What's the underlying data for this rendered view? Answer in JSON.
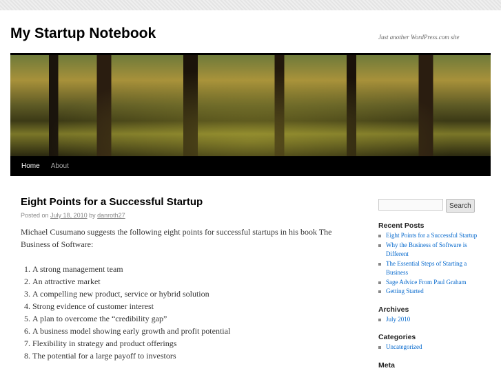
{
  "site": {
    "title": "My Startup Notebook",
    "description": "Just another WordPress.com site"
  },
  "nav": [
    "Home",
    "About"
  ],
  "post": {
    "title": "Eight Points for a Successful Startup",
    "posted_on": "Posted on",
    "date": "July 18, 2010",
    "by": "by",
    "author": "danroth27",
    "intro": "Michael Cusumano suggests the following eight points for successful startups in his book The Business of Software:",
    "points": [
      "A strong management team",
      "An attractive market",
      "A compelling new product, service or hybrid solution",
      "Strong evidence of customer interest",
      "A plan to overcome the “credibility gap”",
      "A business model showing early growth and profit potential",
      "Flexibility in strategy and product offerings",
      "The potential for a large payoff to investors"
    ]
  },
  "sidebar": {
    "search_label": "Search",
    "recent_title": "Recent Posts",
    "recent": [
      "Eight Points for a Successful Startup",
      "Why the Business of Software is Different",
      "The Essential Steps of Starting a Business",
      "Sage Advice From Paul Graham",
      "Getting Started"
    ],
    "archives_title": "Archives",
    "archives": [
      "July 2010"
    ],
    "categories_title": "Categories",
    "categories": [
      "Uncategorized"
    ],
    "meta_title": "Meta"
  }
}
